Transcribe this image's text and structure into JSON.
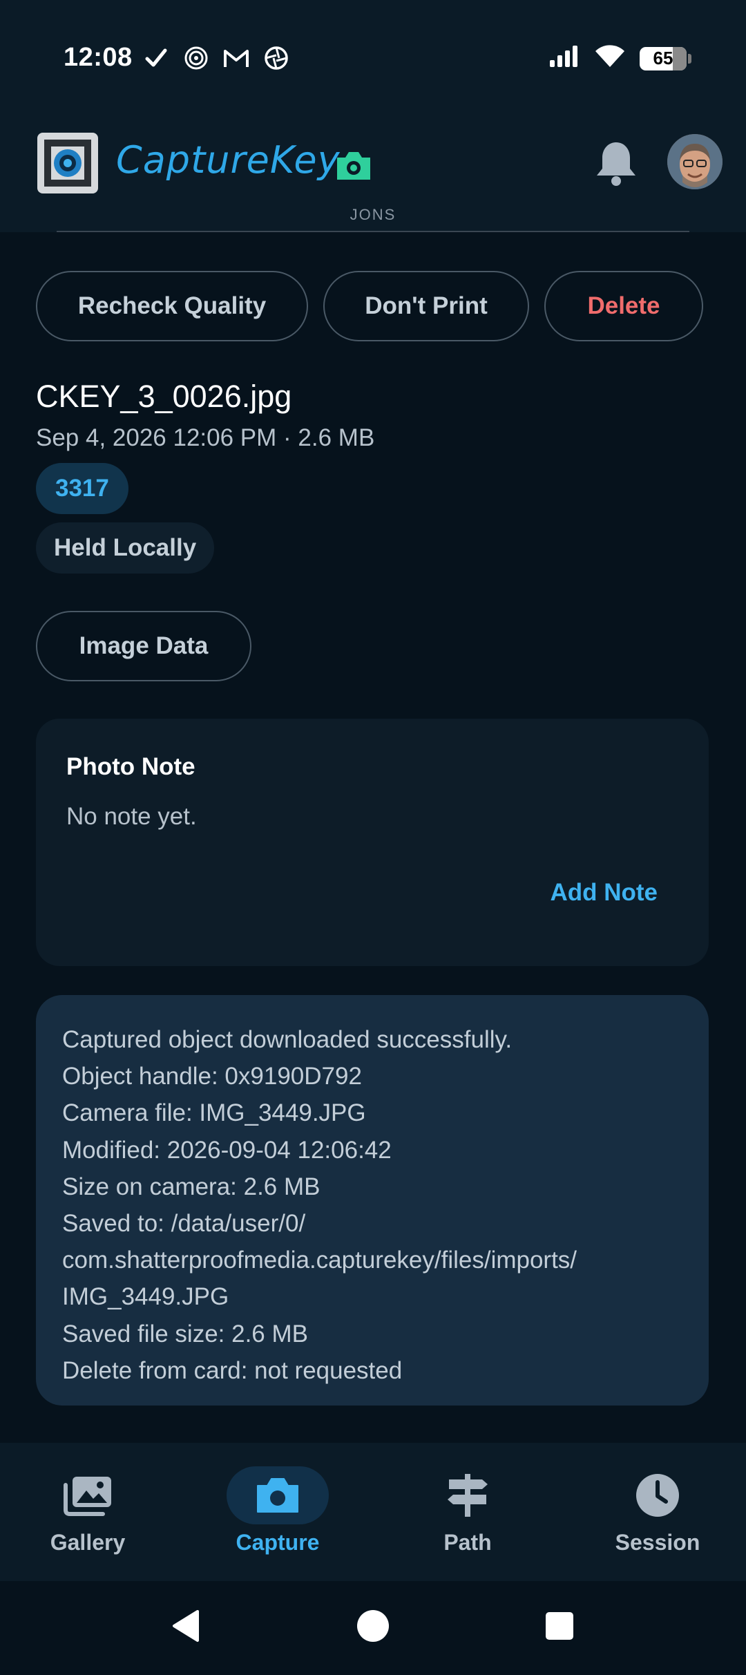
{
  "status_bar": {
    "time": "12:08",
    "battery": "65"
  },
  "header": {
    "brand": "CaptureKey",
    "subtitle": "JONS",
    "accent_color": "#2fa8e8",
    "camera_badge_color": "#2fcf9c"
  },
  "actions": {
    "recheck_label": "Recheck Quality",
    "dont_print_label": "Don't Print",
    "delete_label": "Delete",
    "delete_color": "#f06c6c"
  },
  "file": {
    "name": "CKEY_3_0026.jpg",
    "meta": "Sep 4, 2026  12:06 PM · 2.6 MB",
    "tag_id": "3317",
    "storage_status": "Held Locally",
    "image_data_label": "Image Data"
  },
  "note": {
    "title": "Photo Note",
    "text": "No note yet.",
    "add_label": "Add Note"
  },
  "log": {
    "lines": [
      "Captured object downloaded successfully.",
      "Object handle: 0x9190D792",
      "Camera file: IMG_3449.JPG",
      "Modified: 2026-09-04 12:06:42",
      "Size on camera: 2.6 MB",
      "Saved to: /data/user/0/",
      "com.shatterproofmedia.capturekey/files/imports/",
      "IMG_3449.JPG",
      "Saved file size: 2.6 MB",
      "Delete from card: not requested"
    ]
  },
  "bottom_nav": {
    "items": [
      {
        "label": "Gallery",
        "icon": "gallery-icon"
      },
      {
        "label": "Capture",
        "icon": "camera-icon",
        "active": true
      },
      {
        "label": "Path",
        "icon": "signpost-icon"
      },
      {
        "label": "Session",
        "icon": "clock-icon"
      }
    ]
  }
}
